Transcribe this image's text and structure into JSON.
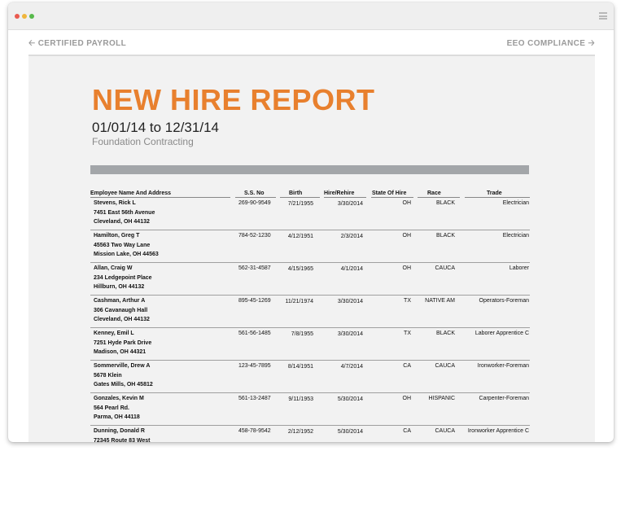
{
  "window": {
    "colors": {
      "title_accent": "#e8802e",
      "rule_gray": "#a3a6a9",
      "background": "#f2f2f2"
    }
  },
  "nav": {
    "prev_label": "CERTIFIED PAYROLL",
    "next_label": "EEO COMPLIANCE",
    "prev_icon": "arrow-left-icon",
    "next_icon": "arrow-right-icon"
  },
  "report": {
    "title": "NEW HIRE REPORT",
    "date_range": "01/01/14 to 12/31/14",
    "company": "Foundation Contracting"
  },
  "table": {
    "headers": {
      "name": "Employee Name And Address",
      "ssn": "S.S. No",
      "birth": "Birth",
      "hire": "Hire/Rehire",
      "state": "State Of Hire",
      "race": "Race",
      "trade": "Trade"
    },
    "rows": [
      {
        "name": "Stevens, Rick L",
        "addr1": "7451 East 56th Avenue",
        "addr2": "Cleveland, OH 44132",
        "ssn": "269-90-9549",
        "birth": "7/21/1955",
        "hire": "3/30/2014",
        "state": "OH",
        "race": "BLACK",
        "trade": "Electrician"
      },
      {
        "name": "Hamilton, Greg T",
        "addr1": "45563 Two Way Lane",
        "addr2": "Mission Lake, OH 44563",
        "ssn": "784-52-1230",
        "birth": "4/12/1951",
        "hire": "2/3/2014",
        "state": "OH",
        "race": "BLACK",
        "trade": "Electrician"
      },
      {
        "name": "Allan, Craig W",
        "addr1": "234 Ledgepoint Place",
        "addr2": "Hillburn, OH 44132",
        "ssn": "562-31-4587",
        "birth": "4/15/1965",
        "hire": "4/1/2014",
        "state": "OH",
        "race": "CAUCA",
        "trade": "Laborer"
      },
      {
        "name": "Cashman, Arthur A",
        "addr1": "306 Cavanaugh Hall",
        "addr2": "Cleveland, OH 44132",
        "ssn": "895-45-1269",
        "birth": "11/21/1974",
        "hire": "3/30/2014",
        "state": "TX",
        "race": "NATIVE AM",
        "trade": "Operators-Foreman"
      },
      {
        "name": "Kenney, Emil L",
        "addr1": "7251 Hyde Park Drive",
        "addr2": "Madison, OH 44321",
        "ssn": "561-56-1485",
        "birth": "7/8/1955",
        "hire": "3/30/2014",
        "state": "TX",
        "race": "BLACK",
        "trade": "Laborer Apprentice C"
      },
      {
        "name": "Sommerville, Drew A",
        "addr1": "5678 Klein",
        "addr2": "Gates Mills, OH 45812",
        "ssn": "123-45-7895",
        "birth": "8/14/1951",
        "hire": "4/7/2014",
        "state": "CA",
        "race": "CAUCA",
        "trade": "Ironworker-Foreman"
      },
      {
        "name": "Gonzales, Kevin M",
        "addr1": "564 Pearl Rd.",
        "addr2": "Parma, OH 44118",
        "ssn": "561-13-2487",
        "birth": "9/11/1953",
        "hire": "5/30/2014",
        "state": "OH",
        "race": "HISPANIC",
        "trade": "Carpenter-Foreman"
      },
      {
        "name": "Dunning, Donald R",
        "addr1": "72345 Route 83 West",
        "addr2": "",
        "ssn": "458-78-9542",
        "birth": "2/12/1952",
        "hire": "5/30/2014",
        "state": "CA",
        "race": "CAUCA",
        "trade": "Ironworker Apprentice C"
      }
    ]
  }
}
